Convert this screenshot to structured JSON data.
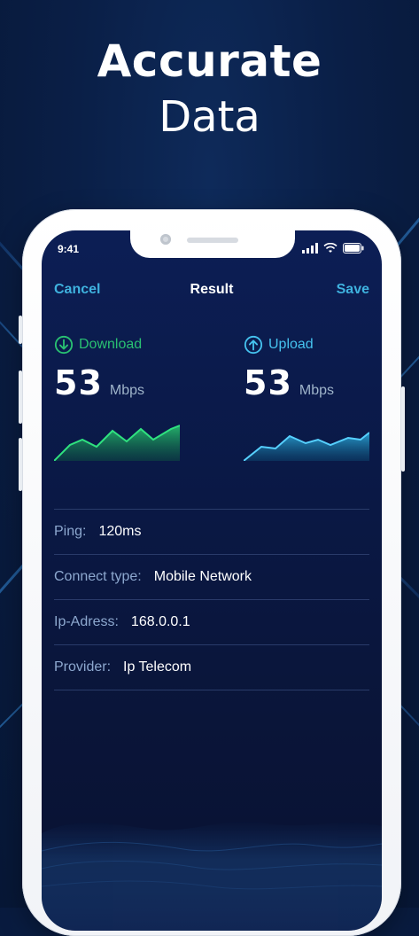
{
  "headline": {
    "line1": "Accurate",
    "line2": "Data"
  },
  "status": {
    "time": "9:41"
  },
  "nav": {
    "left": "Cancel",
    "title": "Result",
    "right": "Save"
  },
  "metrics": {
    "download": {
      "label": "Download",
      "value": "53",
      "unit": "Mbps",
      "icon": "arrow-down-circle-icon",
      "color": "#29c172"
    },
    "upload": {
      "label": "Upload",
      "value": "53",
      "unit": "Mbps",
      "icon": "arrow-up-circle-icon",
      "color": "#45c2ee"
    }
  },
  "info": [
    {
      "label": "Ping:",
      "value": "120ms"
    },
    {
      "label": "Connect type:",
      "value": "Mobile Network"
    },
    {
      "label": "Ip-Adress:",
      "value": "168.0.0.1"
    },
    {
      "label": "Provider:",
      "value": "Ip Telecom"
    }
  ],
  "theme": {
    "accent": "#3fb2df",
    "background": "#0a1f47"
  }
}
